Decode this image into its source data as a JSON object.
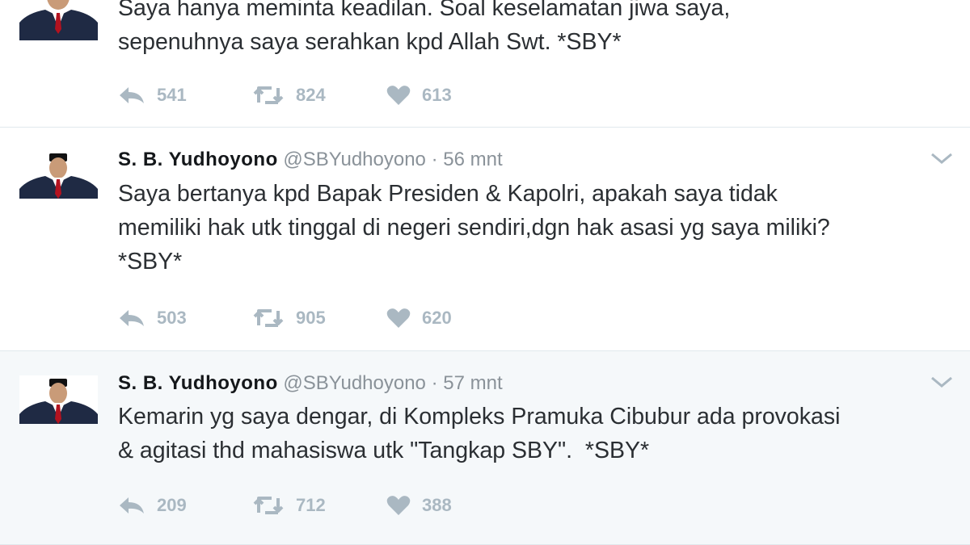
{
  "tweets": [
    {
      "name": "",
      "handle": "",
      "time": "",
      "text": "Saya hanya meminta keadilan. Soal keselamatan jiwa saya,\nsepenuhnya saya serahkan kpd Allah Swt. *SBY*",
      "replies": "541",
      "retweets": "824",
      "likes": "613"
    },
    {
      "name": "S. B. Yudhoyono",
      "handle": "@SBYudhoyono",
      "separator": "·",
      "time": "56 mnt",
      "text": "Saya bertanya kpd Bapak Presiden & Kapolri, apakah saya tidak\nmemiliki hak utk tinggal di negeri sendiri,dgn hak asasi yg saya miliki?\n*SBY*",
      "replies": "503",
      "retweets": "905",
      "likes": "620"
    },
    {
      "name": "S. B. Yudhoyono",
      "handle": "@SBYudhoyono",
      "separator": "·",
      "time": "57 mnt",
      "text": "Kemarin yg saya dengar, di Kompleks Pramuka Cibubur ada provokasi\n& agitasi thd mahasiswa utk \"Tangkap SBY\".  *SBY*",
      "replies": "209",
      "retweets": "712",
      "likes": "388"
    }
  ],
  "icons": {
    "reply": "reply-icon",
    "retweet": "retweet-icon",
    "like": "heart-icon",
    "caret": "chevron-down-icon"
  },
  "colors": {
    "highlight_bg": "#f5f8fa",
    "action_gray": "#aab8c2",
    "meta_gray": "#8a9299"
  }
}
